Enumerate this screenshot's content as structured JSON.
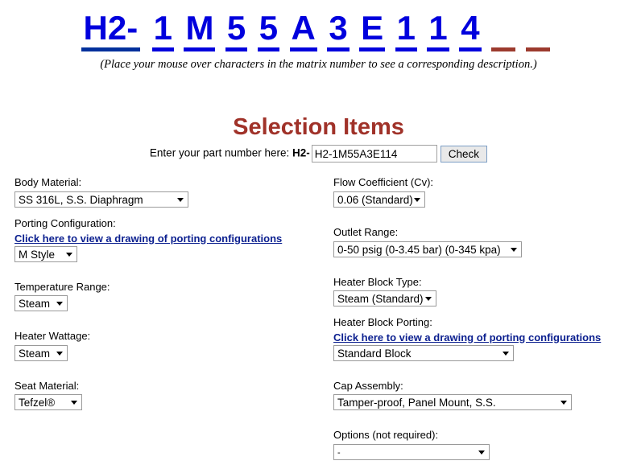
{
  "header": {
    "matrix_cells": [
      {
        "text": "H2-",
        "type": "prefix",
        "filled": true
      },
      {
        "text": "1",
        "type": "char",
        "filled": true
      },
      {
        "text": "M",
        "type": "char",
        "filled": true
      },
      {
        "text": "5",
        "type": "char",
        "filled": true
      },
      {
        "text": "5",
        "type": "char",
        "filled": true
      },
      {
        "text": "A",
        "type": "char",
        "filled": true
      },
      {
        "text": "3",
        "type": "char",
        "filled": true
      },
      {
        "text": "E",
        "type": "char",
        "filled": true
      },
      {
        "text": "1",
        "type": "char",
        "filled": true
      },
      {
        "text": "1",
        "type": "char",
        "filled": true
      },
      {
        "text": "4",
        "type": "char",
        "filled": true
      },
      {
        "text": "_",
        "type": "empty",
        "filled": false
      },
      {
        "text": "_",
        "type": "empty",
        "filled": false
      }
    ],
    "note": "(Place your mouse over characters in the matrix number to see a corresponding description.)",
    "matrix_color": "#0000dd",
    "empty_color": "#9c3a2e"
  },
  "section": {
    "title": "Selection Items",
    "title_color": "#a03229"
  },
  "partnumber": {
    "label": "Enter your part number here:",
    "prefix": "H2-",
    "value": "H2-1M55A3E114",
    "placeholder": "",
    "check_label": "Check"
  },
  "left_column": [
    {
      "label": "Body Material:",
      "link": null,
      "value": "SS 316L, S.S. Diaphragm"
    },
    {
      "label": "Porting Configuration:",
      "link": "Click here to view a drawing of porting configurations",
      "value": "M Style"
    },
    {
      "label": "Temperature Range:",
      "link": null,
      "value": "Steam"
    },
    {
      "label": "Heater Wattage:",
      "link": null,
      "value": "Steam"
    },
    {
      "label": "Seat Material:",
      "link": null,
      "value": "Tefzel®"
    }
  ],
  "right_column": [
    {
      "label": "Flow Coefficient (Cv):",
      "link": null,
      "value": "0.06 (Standard)"
    },
    {
      "label": "Outlet Range:",
      "link": null,
      "value": "0-50 psig (0-3.45 bar) (0-345 kpa)"
    },
    {
      "label": "Heater Block Type:",
      "link": null,
      "value": "Steam (Standard)"
    },
    {
      "label": "Heater Block Porting:",
      "link": "Click here to view a drawing of porting configurations",
      "value": "Standard Block"
    },
    {
      "label": "Cap Assembly:",
      "link": null,
      "value": "Tamper-proof, Panel Mount, S.S."
    },
    {
      "label": "Options (not required):",
      "link": null,
      "value": "-"
    }
  ]
}
